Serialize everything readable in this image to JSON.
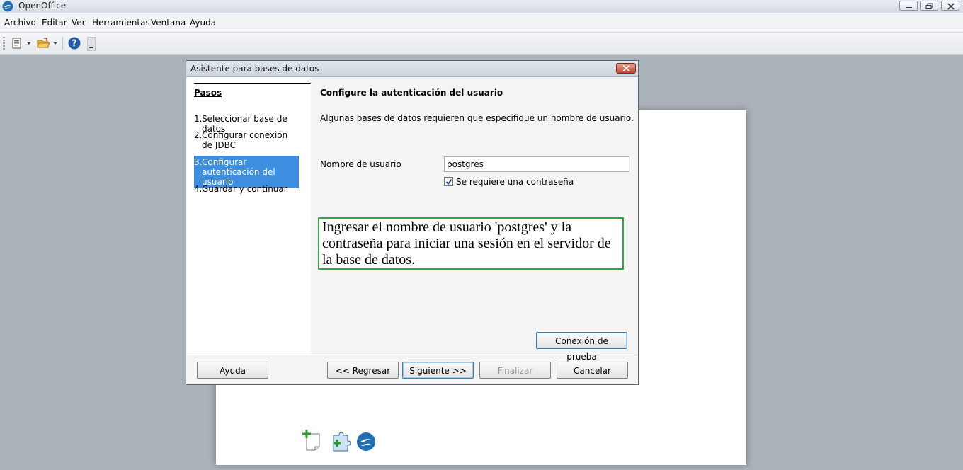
{
  "window": {
    "title": "OpenOffice"
  },
  "menu": {
    "items": [
      "Archivo",
      "Editar",
      "Ver",
      "Herramientas",
      "Ventana",
      "Ayuda"
    ]
  },
  "toolbar": {
    "icons": [
      "new-document-icon",
      "open-folder-icon",
      "help-icon"
    ]
  },
  "dialog": {
    "title": "Asistente para bases de datos",
    "steps_header": "Pasos",
    "steps": [
      {
        "num": "1.",
        "label": "Seleccionar base de datos"
      },
      {
        "num": "2.",
        "label": "Configurar conexión de JDBC"
      },
      {
        "num": "3.",
        "label": "Configurar autenticación del usuario",
        "selected": true
      },
      {
        "num": "4.",
        "label": "Guardar y continuar"
      }
    ],
    "content": {
      "title": "Configure la autenticación del usuario",
      "description": "Algunas bases de datos requieren que especifique un nombre de usuario.",
      "username_label": "Nombre de usuario",
      "username_value": "postgres",
      "password_required_label": "Se requiere una contraseña",
      "password_required_checked": true,
      "annotation": "Ingresar el nombre de usuario 'postgres' y la contraseña para iniciar una sesión en el servidor de la base de datos.",
      "test_button": "Conexión de prueba"
    },
    "buttons": {
      "help": "Ayuda",
      "back": "<< Regresar",
      "next": "Siguiente >>",
      "finish": "Finalizar",
      "cancel": "Cancelar"
    }
  },
  "colors": {
    "selected_step": "#3d8ee0",
    "annotation_border": "#2eaa46",
    "close_button": "#c4452f"
  }
}
